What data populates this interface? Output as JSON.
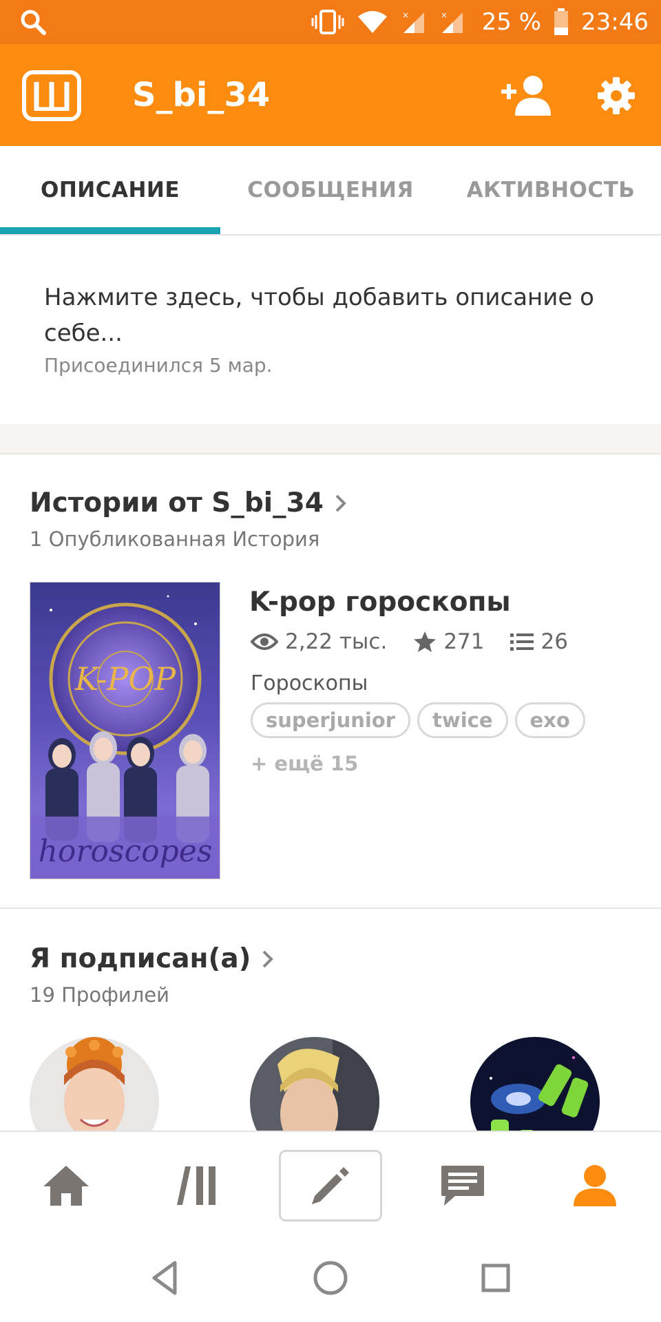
{
  "status_bar": {
    "battery": "25 %",
    "time": "23:46"
  },
  "app_bar": {
    "title": "S_bi_34"
  },
  "tabs": [
    {
      "label": "ОПИСАНИЕ",
      "active": true
    },
    {
      "label": "СООБЩЕНИЯ",
      "active": false
    },
    {
      "label": "АКТИВНОСТЬ",
      "active": false
    }
  ],
  "description": {
    "text": "Нажмите здесь, чтобы добавить описание о себе...",
    "joined": "Присоединился 5 мар."
  },
  "stories": {
    "title": "Истории от S_bi_34",
    "subtitle": "1 Опубликованная История",
    "items": [
      {
        "title": "K-pop гороскопы",
        "views": "2,22 тыс.",
        "votes": "271",
        "parts": "26",
        "genre": "Гороскопы",
        "tags": [
          "superjunior",
          "twice",
          "exo"
        ],
        "more": "+ ещё 15",
        "cover_text": "K-POP",
        "cover_subtitle": "horoscopes"
      }
    ]
  },
  "following": {
    "title": "Я подписан(а)",
    "subtitle": "19 Профилей"
  },
  "colors": {
    "status_bar": "#f37a14",
    "app_bar": "#fb8c10",
    "tab_indicator": "#1aa1b2",
    "active_nav": "#fb8c10",
    "inactive_nav": "#7a7570"
  }
}
